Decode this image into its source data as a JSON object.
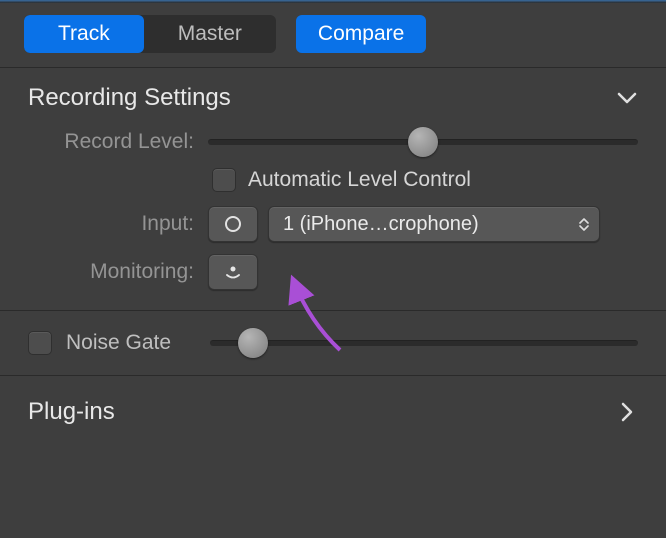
{
  "tabs": {
    "track": "Track",
    "master": "Master",
    "compare": "Compare"
  },
  "recording": {
    "title": "Recording Settings",
    "record_level_label": "Record Level:",
    "record_level_value": 50,
    "auto_level_label": "Automatic Level Control",
    "input_label": "Input:",
    "input_value": "1  (iPhone…crophone)",
    "monitoring_label": "Monitoring:"
  },
  "noise_gate": {
    "label": "Noise Gate",
    "value": 10
  },
  "plugins": {
    "title": "Plug-ins"
  },
  "colors": {
    "accent": "#0a72e8",
    "annotation": "#a94fd6"
  }
}
